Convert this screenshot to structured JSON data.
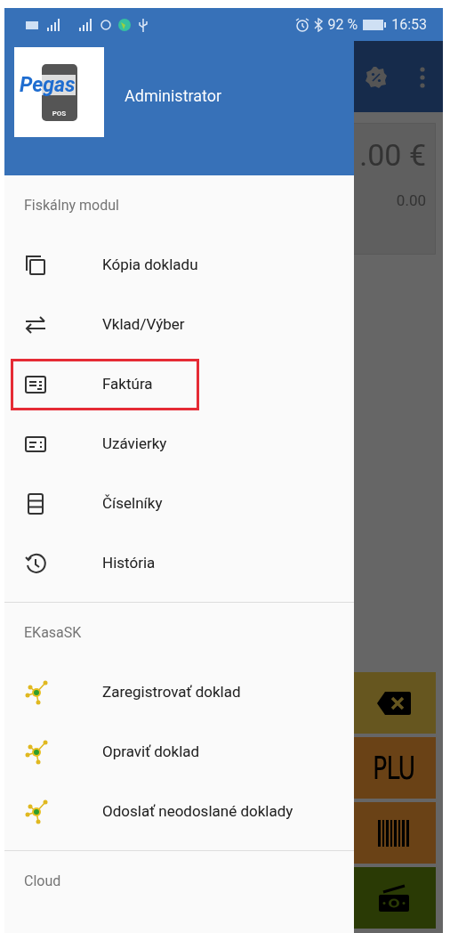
{
  "status_bar": {
    "battery": "92 %",
    "time": "16:53"
  },
  "drawer": {
    "user": "Administrator",
    "logo": {
      "name": "Pegas",
      "sub": "POS"
    },
    "sections": [
      {
        "title": "Fiskálny modul",
        "items": [
          {
            "kind": "copy",
            "label": "Kópia dokladu",
            "highlighted": false
          },
          {
            "kind": "transfer",
            "label": "Vklad/Výber",
            "highlighted": false
          },
          {
            "kind": "invoice",
            "label": "Faktúra",
            "highlighted": true
          },
          {
            "kind": "closing",
            "label": "Uzávierky",
            "highlighted": false
          },
          {
            "kind": "lists",
            "label": "Číselníky",
            "highlighted": false
          },
          {
            "kind": "history",
            "label": "História",
            "highlighted": false
          }
        ]
      },
      {
        "title": "EKasaSK",
        "items": [
          {
            "kind": "ekasa",
            "label": "Zaregistrovať doklad",
            "highlighted": false
          },
          {
            "kind": "ekasa",
            "label": "Opraviť doklad",
            "highlighted": false
          },
          {
            "kind": "ekasa",
            "label": "Odoslať neodoslané doklady",
            "highlighted": false
          }
        ]
      },
      {
        "title": "Cloud"
      }
    ]
  },
  "background": {
    "total": ".00 €",
    "subtotal": "0.00",
    "keys": [
      {
        "kind": "backspace"
      },
      {
        "kind": "text",
        "label": "PLU"
      },
      {
        "kind": "barcode"
      },
      {
        "kind": "cash"
      }
    ]
  }
}
